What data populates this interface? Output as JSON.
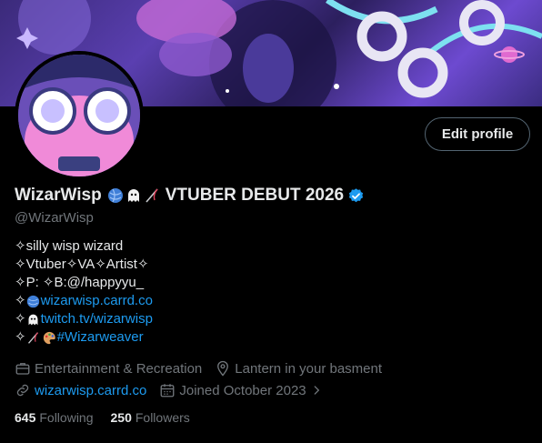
{
  "profile": {
    "display_name": "WizarWisp",
    "name_suffix": "VTUBER DEBUT 2026",
    "handle": "@WizarWisp",
    "edit_label": "Edit profile"
  },
  "bio": {
    "line1": "✧silly wisp wizard",
    "line2": "✧Vtuber✧VA✧Artist✧",
    "line3": "✧P: ✧B:@/happyyu_",
    "line4_prefix": "✧",
    "line4_link": "wizarwisp.carrd.co",
    "line5_prefix": "✧",
    "line5_link": "twitch.tv/wizarwisp",
    "line6_prefix": "✧",
    "line6_link": "#Wizarweaver"
  },
  "meta": {
    "category": "Entertainment & Recreation",
    "location": "Lantern in your basment",
    "website": "wizarwisp.carrd.co",
    "joined": "Joined October 2023"
  },
  "stats": {
    "following_count": "645",
    "following_label": "Following",
    "followers_count": "250",
    "followers_label": "Followers"
  },
  "colors": {
    "link": "#1d9bf0",
    "muted": "#71767b",
    "text": "#e7e9ea",
    "background": "#000000"
  }
}
